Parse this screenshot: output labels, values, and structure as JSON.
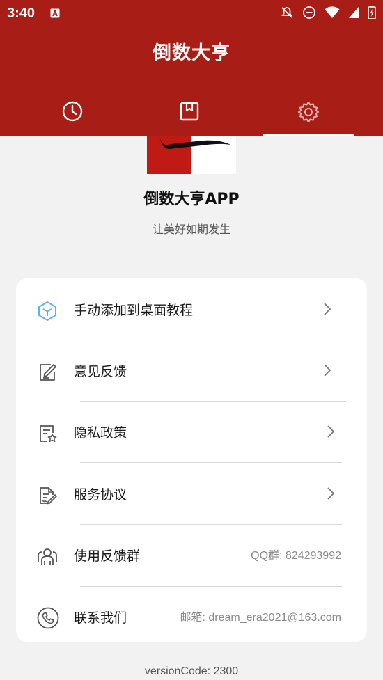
{
  "status_bar": {
    "time": "3:40",
    "left_icon": "a-notification-icon",
    "right_icons": [
      "notifications-off-icon",
      "do-not-disturb-icon",
      "wifi-icon",
      "signal-icon",
      "battery-charging-icon"
    ]
  },
  "header": {
    "title": "倒数大亨",
    "background_color": "#a81e16"
  },
  "tabs": [
    {
      "icon": "clock-icon",
      "selected": false
    },
    {
      "icon": "bookmark-icon",
      "selected": false
    },
    {
      "icon": "gear-icon",
      "selected": true
    }
  ],
  "about": {
    "app_name": "倒数大亨APP",
    "tagline": "让美好如期发生"
  },
  "menu": {
    "items": [
      {
        "label": "手动添加到桌面教程",
        "icon": "cube-icon",
        "trailing": "chevron"
      },
      {
        "label": "意见反馈",
        "icon": "feedback-edit-icon",
        "trailing": "chevron"
      },
      {
        "label": "隐私政策",
        "icon": "privacy-document-icon",
        "trailing": "chevron"
      },
      {
        "label": "服务协议",
        "icon": "agreement-document-icon",
        "trailing": "chevron"
      },
      {
        "label": "使用反馈群",
        "icon": "group-icon",
        "value": "QQ群: 824293992"
      },
      {
        "label": "联系我们",
        "icon": "phone-icon",
        "value": "邮箱: dream_era2021@163.com"
      }
    ]
  },
  "footer": {
    "version": "versionCode: 2300"
  }
}
